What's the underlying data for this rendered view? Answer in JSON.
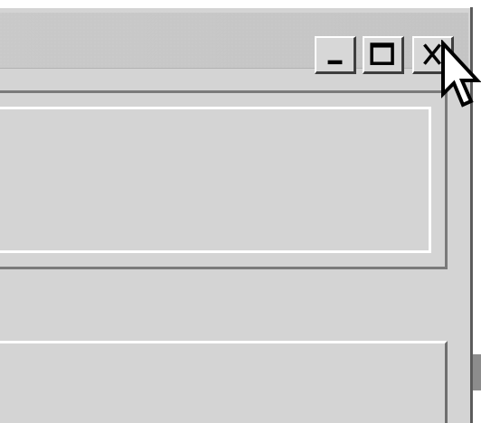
{
  "window": {
    "title": "",
    "controls": {
      "minimize_icon": "minimize-icon",
      "maximize_icon": "maximize-icon",
      "close_icon": "close-icon"
    }
  },
  "cursor": {
    "icon": "mouse-pointer-icon"
  },
  "colors": {
    "window_face": "#d4d4d4",
    "titlebar": "#c6c6c6",
    "dark_bevel": "#3e3e3e",
    "light_bevel": "#ffffff"
  }
}
